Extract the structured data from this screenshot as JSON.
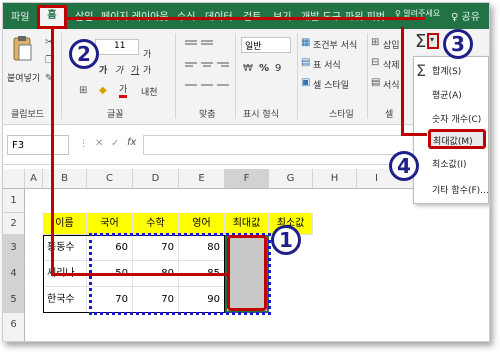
{
  "tabs": [
    "파일",
    "홈",
    "삽입",
    "페이지 레이아웃",
    "수식",
    "데이터",
    "검토",
    "보기",
    "개발 도구",
    "파워 피벗",
    "♀ 알려주세요",
    "♀ 공유"
  ],
  "ribbon": {
    "paste_label": "붙여넣기",
    "clipboard_label": "클립보드",
    "font_size": "11",
    "font_group_label": "글꼴",
    "bold": "가",
    "italic": "가",
    "underline": "가",
    "font_color_sample": "가",
    "increase_font": "가",
    "decrease_font": "가",
    "phonetic": "내천",
    "align_group_label": "맞춤",
    "number_format": "일반",
    "number_group_label": "표시 형식",
    "currency": "%",
    "comma": "9",
    "cond_format": "조건부 서식",
    "table_format": "표 서식",
    "cell_style": "셀 스타일",
    "style_group_label": "스타일",
    "insert": "삽입",
    "delete": "삭제",
    "format": "서식",
    "cells_group_label": "셀",
    "sigma": "Σ"
  },
  "autosum_menu": {
    "items": [
      "합계(S)",
      "평균(A)",
      "숫자 개수(C)",
      "최대값(M)",
      "최소값(I)",
      "기타 함수(F)..."
    ],
    "highlighted": "최대값(M)"
  },
  "formula_bar": {
    "name_box": "F3",
    "fx": "fx",
    "cancel": "✕",
    "enter": "✓"
  },
  "sheet": {
    "columns": [
      "A",
      "B",
      "C",
      "D",
      "E",
      "F",
      "G",
      "H",
      "I"
    ],
    "rows": [
      "1",
      "2",
      "3",
      "4",
      "5",
      "6"
    ],
    "header_row": [
      "이름",
      "국어",
      "수학",
      "영어",
      "최대값",
      "최소값"
    ],
    "data": [
      {
        "name": "홍동수",
        "kor": "60",
        "math": "70",
        "eng": "80"
      },
      {
        "name": "세리나",
        "kor": "50",
        "math": "80",
        "eng": "85"
      },
      {
        "name": "한국수",
        "kor": "70",
        "math": "70",
        "eng": "90"
      }
    ]
  },
  "annotations": [
    "1",
    "2",
    "3",
    "4"
  ],
  "colors": {
    "excel_green": "#217346",
    "annotation_red": "#c00000",
    "badge_blue": "#1f1f8a",
    "header_yellow": "#ffff00"
  }
}
